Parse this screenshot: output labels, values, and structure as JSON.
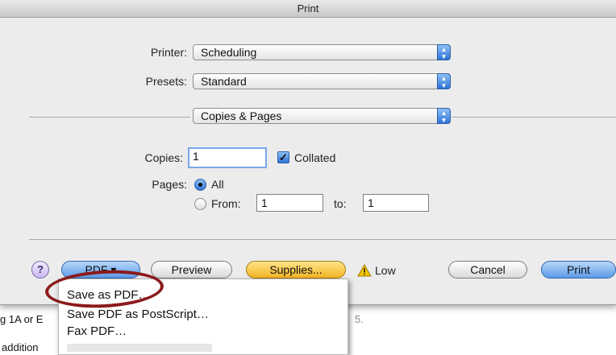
{
  "window": {
    "title": "Print"
  },
  "printer": {
    "label": "Printer:",
    "value": "Scheduling"
  },
  "presets": {
    "label": "Presets:",
    "value": "Standard"
  },
  "section": {
    "value": "Copies & Pages"
  },
  "copies": {
    "label": "Copies:",
    "value": "1",
    "collated_label": "Collated",
    "collated_checked": true
  },
  "pages": {
    "label": "Pages:",
    "all_label": "All",
    "from_label": "From:",
    "from_value": "1",
    "to_label": "to:",
    "to_value": "1",
    "selected": "All"
  },
  "footer": {
    "help_label": "?",
    "pdf_label": "PDF ▾",
    "preview_label": "Preview",
    "supplies_label": "Supplies...",
    "low_label": "Low",
    "cancel_label": "Cancel",
    "print_label": "Print"
  },
  "pdf_menu": {
    "items": [
      "Save as PDF…",
      "Save PDF as PostScript…",
      "Fax PDF…"
    ]
  },
  "background": {
    "line1_start": "g 1A or E",
    "line1_end": "5.",
    "line2_start": "addition"
  },
  "colors": {
    "accent": "#2e74d6",
    "annotation": "#8b1a1a",
    "warning": "#f2c200"
  }
}
